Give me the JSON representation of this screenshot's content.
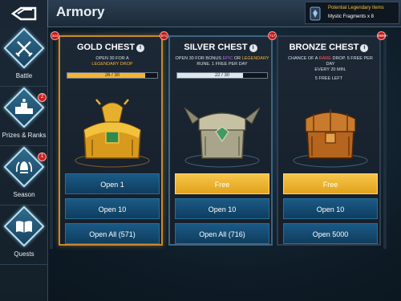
{
  "header": {
    "title": "Armory",
    "legendary_title": "Potential Legendary Items",
    "legendary_sub": "Mystic Fragments x 8"
  },
  "sidebar": {
    "items": [
      {
        "label": "Battle",
        "icon": "crossed-swords-icon",
        "badge": ""
      },
      {
        "label": "Prizes & Ranks",
        "icon": "podium-icon",
        "badge": "2"
      },
      {
        "label": "Season",
        "icon": "laurel-helmet-icon",
        "badge": "1"
      },
      {
        "label": "Quests",
        "icon": "open-book-icon",
        "badge": ""
      }
    ]
  },
  "cards": {
    "gold": {
      "title": "GOLD CHEST",
      "badge_left": "344",
      "badge_right": "571",
      "desc_pre": "OPEN 30 FOR A",
      "desc_hl": "LEGENDARY DROP",
      "progress_text": "26 / 30",
      "progress": 0.8667,
      "buttons": [
        "Open 1",
        "Open 10",
        "Open All (571)"
      ]
    },
    "silver": {
      "title": "SILVER CHEST",
      "badge_right": "717",
      "desc_a": "OPEN 30 FOR BONUS",
      "desc_epic": "EPIC",
      "desc_or": "OR",
      "desc_leg": "LEGENDARY",
      "desc_b": "RUNE. 1 FREE PER DAY",
      "progress_text": "22 / 30",
      "progress": 0.7333,
      "buttons": [
        "Free",
        "Open 10",
        "Open All (716)"
      ]
    },
    "bronze": {
      "title": "BRONZE CHEST",
      "badge_right": "9999+",
      "desc_a": "CHANCE OF A",
      "desc_rare": "RARE",
      "desc_b": "DROP. 5 FREE PER DAY",
      "desc_c": "EVERY 20 MIN.",
      "free_left": "5 FREE LEFT",
      "buttons": [
        "Free",
        "Open 10",
        "Open 5000"
      ]
    }
  },
  "colors": {
    "gold_border": "#c9892c",
    "blue_button": "#1a5a86",
    "yellow_button": "#f6c64a",
    "badge_red": "#c21818",
    "legendary_orange": "#f2b534",
    "epic_purple": "#b86ae8"
  }
}
